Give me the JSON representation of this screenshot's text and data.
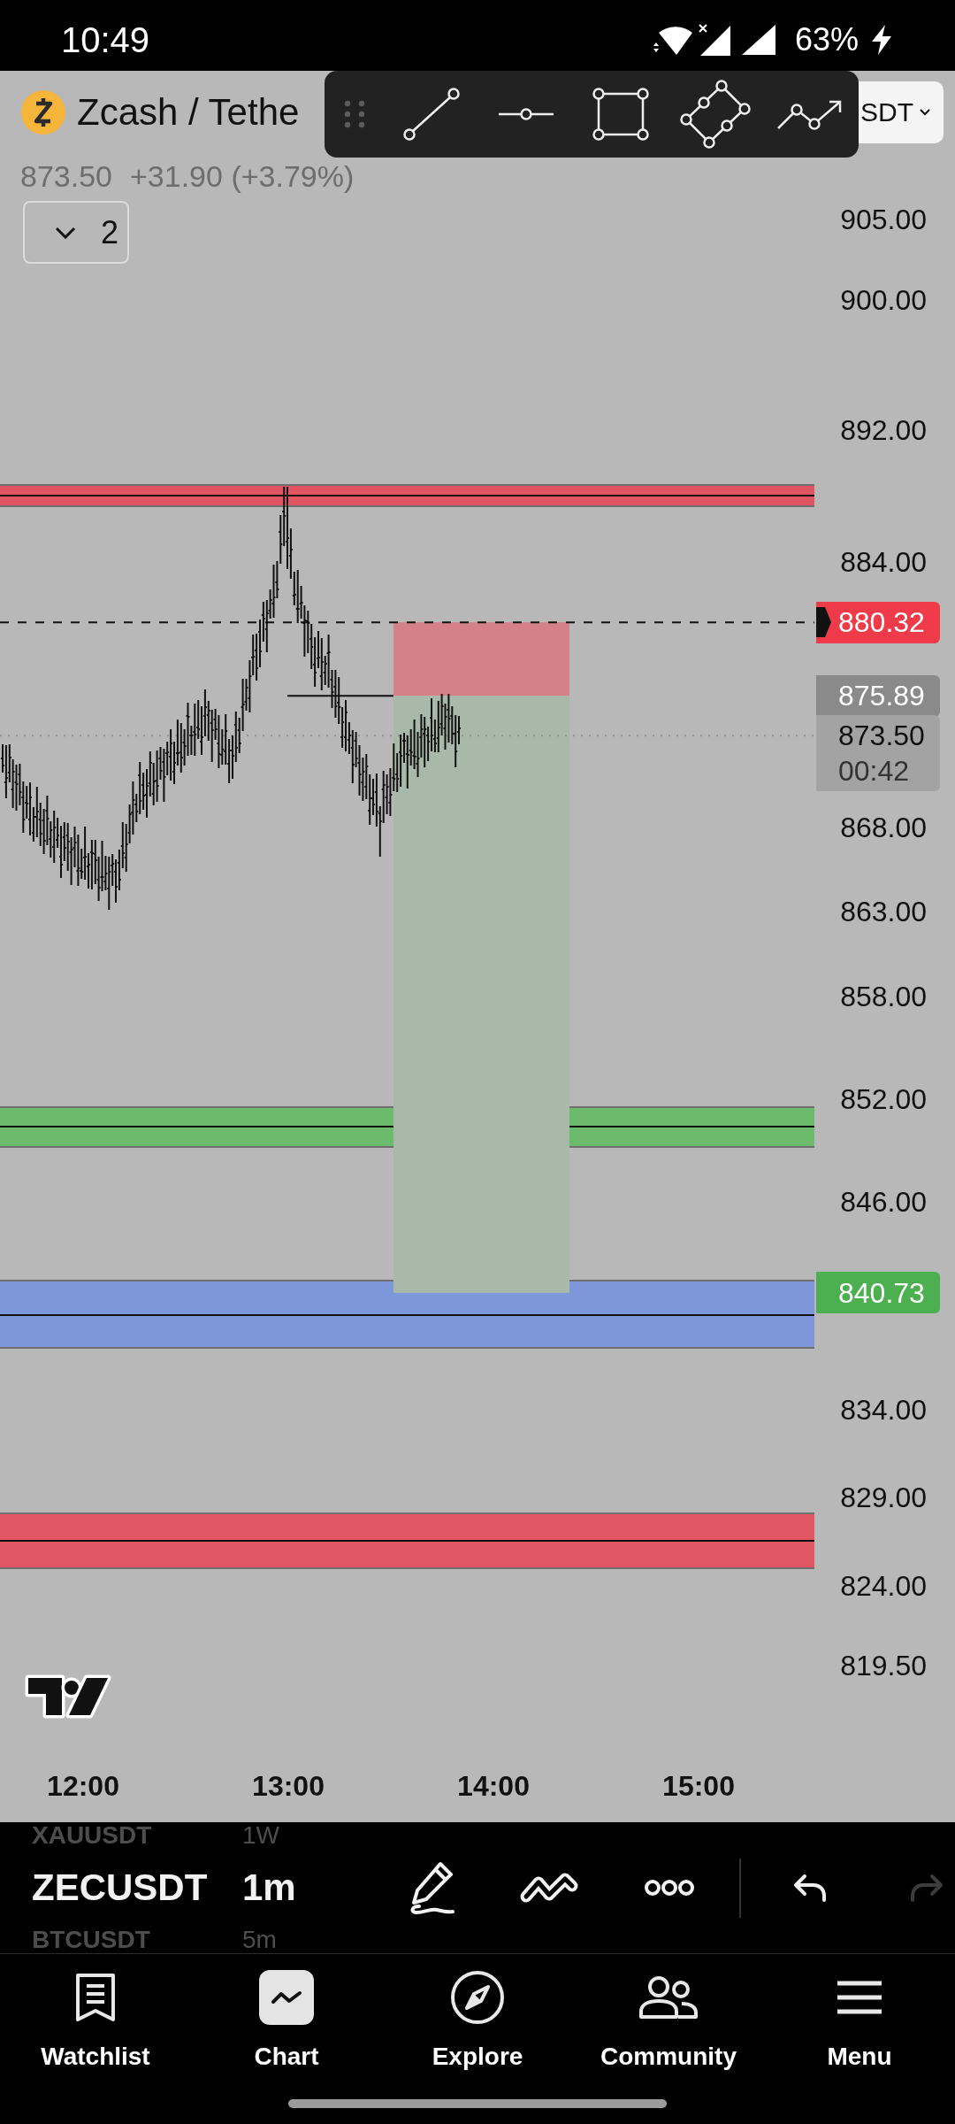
{
  "status_bar": {
    "time": "10:49",
    "battery": "63%"
  },
  "header": {
    "title": "Zcash / Tethe",
    "currency_button": "SDT",
    "price": "873.50",
    "change": "+31.90 (+3.79%)",
    "indicators_toggle": "2"
  },
  "price_axis": [
    "905.00",
    "900.00",
    "892.00",
    "884.00",
    "868.00",
    "863.00",
    "858.00",
    "852.00",
    "846.00",
    "834.00",
    "829.00",
    "824.00",
    "819.50"
  ],
  "price_tags": [
    {
      "kind": "stop",
      "text": "880.32",
      "color": "#ef3b49"
    },
    {
      "kind": "entry",
      "text": "875.89",
      "color": "#8a8a8a"
    },
    {
      "kind": "last",
      "text": "873.50",
      "countdown": "00:42",
      "color": "#a3a3a3"
    },
    {
      "kind": "target",
      "text": "840.73",
      "color": "#4caf50"
    }
  ],
  "time_axis": [
    "12:00",
    "13:00",
    "14:00",
    "15:00"
  ],
  "symbols": [
    {
      "symbol": "XAUUSDT",
      "interval": "1W",
      "selected": false
    },
    {
      "symbol": "ZECUSDT",
      "interval": "1m",
      "selected": true
    },
    {
      "symbol": "BTCUSDT",
      "interval": "5m",
      "selected": false
    }
  ],
  "edit_tools": {
    "undo": {
      "disabled": false
    },
    "redo": {
      "disabled": true
    }
  },
  "nav": [
    {
      "label": "Watchlist",
      "selected": false
    },
    {
      "label": "Chart",
      "selected": true
    },
    {
      "label": "Explore",
      "selected": false
    },
    {
      "label": "Community",
      "selected": false
    },
    {
      "label": "Menu",
      "selected": false
    }
  ]
}
